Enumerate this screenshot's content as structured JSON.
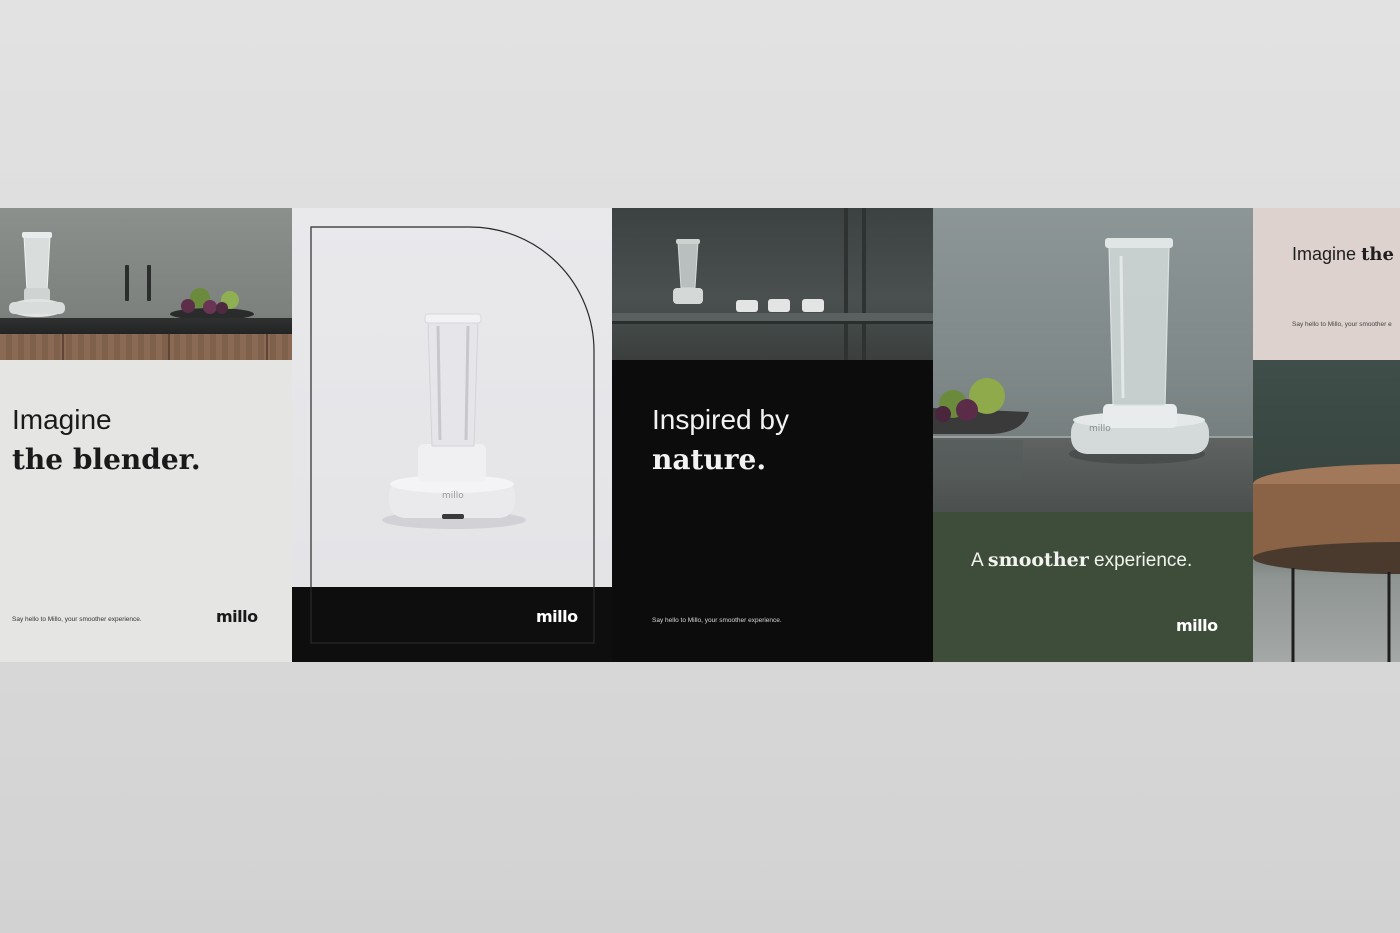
{
  "poster_1": {
    "headline_light": "Imagine",
    "headline_bold": "the blender.",
    "tagline": "Say hello to Millo, your smoother experience.",
    "logo": "millo"
  },
  "poster_2": {
    "product_logo": "millo",
    "logo": "millo"
  },
  "poster_3": {
    "headline_light": "Inspired by",
    "headline_bold": "nature.",
    "tagline": "Say hello to Millo, your smoother experience."
  },
  "poster_4": {
    "headline_pre": "A",
    "headline_bold": "smoother",
    "headline_post": "experience.",
    "product_logo": "millo",
    "logo": "millo"
  },
  "poster_5": {
    "headline_light": "Imagine",
    "headline_bold": "the",
    "tagline": "Say hello to Millo, your smoother e"
  },
  "colors": {
    "background": "#dcdcdc",
    "poster_light": "#e5e5e4",
    "poster_black": "#0c0c0c",
    "poster_green": "#3d4d39",
    "poster_blush": "#ddd2cd"
  }
}
